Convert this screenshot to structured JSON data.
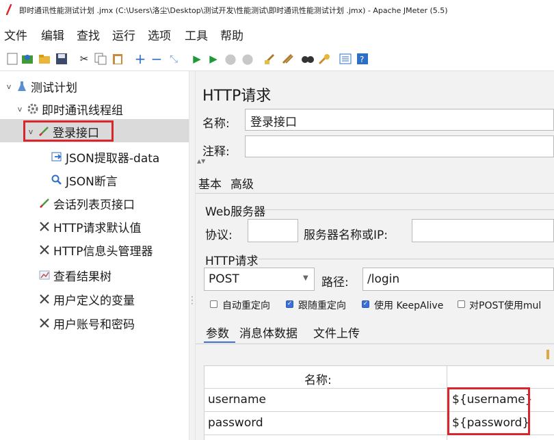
{
  "window": {
    "title": "即时通讯性能测试计划 .jmx (C:\\Users\\洛尘\\Desktop\\测试开发\\性能测试\\即时通讯性能测试计划 .jmx) - Apache JMeter (5.5)"
  },
  "menu": [
    "文件",
    "编辑",
    "查找",
    "运行",
    "选项",
    "工具",
    "帮助"
  ],
  "toolbar": {
    "icons": [
      "new-icon",
      "templates-icon",
      "open-icon",
      "save-icon",
      "cut-icon",
      "copy-icon",
      "paste-icon",
      "expand-icon",
      "collapse-icon",
      "toggle-icon",
      "start-icon",
      "start-no-pause-icon",
      "stop-icon",
      "shutdown-icon",
      "clear-icon",
      "clear-all-icon",
      "search-icon",
      "reset-search-icon",
      "function-helper-icon",
      "help-icon"
    ]
  },
  "tree": {
    "items": [
      {
        "label": "测试计划",
        "icon": "test-plan-icon",
        "expand": "v"
      },
      {
        "label": "即时通讯线程组",
        "icon": "thread-group-icon",
        "expand": "v"
      },
      {
        "label": "登录接口",
        "icon": "sampler-icon",
        "expand": "v"
      },
      {
        "label": "JSON提取器-data",
        "icon": "extractor-icon",
        "expand": ""
      },
      {
        "label": "JSON断言",
        "icon": "assertion-icon",
        "expand": ""
      },
      {
        "label": "会话列表页接口",
        "icon": "sampler-icon",
        "expand": ""
      },
      {
        "label": "HTTP请求默认值",
        "icon": "config-icon",
        "expand": ""
      },
      {
        "label": "HTTP信息头管理器",
        "icon": "config-icon",
        "expand": ""
      },
      {
        "label": "查看结果树",
        "icon": "listener-icon",
        "expand": ""
      },
      {
        "label": "用户定义的变量",
        "icon": "config-icon",
        "expand": ""
      },
      {
        "label": "用户账号和密码",
        "icon": "config-icon",
        "expand": ""
      }
    ]
  },
  "panel": {
    "heading": "HTTP请求",
    "name_label": "名称:",
    "name_value": "登录接口",
    "comment_label": "注释:",
    "comment_value": "",
    "tabs": [
      "基本",
      "高级"
    ],
    "web_server_group": "Web服务器",
    "protocol_label": "协议:",
    "protocol_value": "",
    "server_label": "服务器名称或IP:",
    "server_value": "",
    "http_request_group": "HTTP请求",
    "method": "POST",
    "path_label": "路径:",
    "path_value": "/login",
    "options": [
      {
        "label": "自动重定向",
        "checked": false
      },
      {
        "label": "跟随重定向",
        "checked": true
      },
      {
        "label": "使用 KeepAlive",
        "checked": true
      },
      {
        "label": "对POST使用mul",
        "checked": false
      }
    ],
    "subtabs": [
      "参数",
      "消息体数据",
      "文件上传"
    ]
  },
  "params_table": {
    "header_name": "名称:",
    "rows": [
      {
        "name": "username",
        "value": "${username}"
      },
      {
        "name": "password",
        "value": "${password}"
      }
    ]
  }
}
